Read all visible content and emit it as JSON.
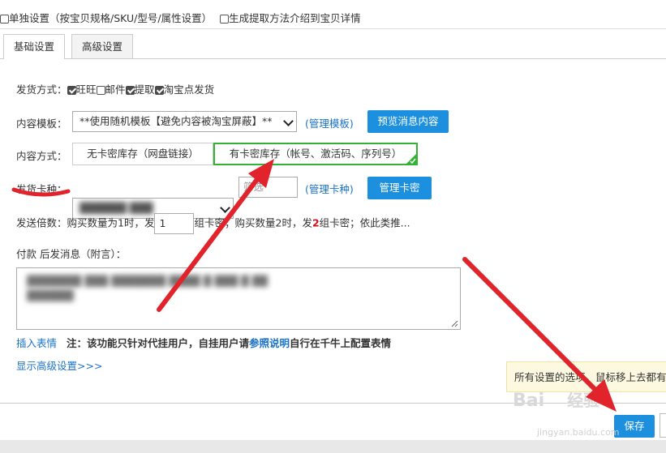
{
  "top_options": {
    "separate": "单独设置（按宝贝规格/SKU/型号/属性设置）",
    "intro": "生成提取方法介绍到宝贝详情"
  },
  "tabs": [
    {
      "label": "基础设置",
      "active": true
    },
    {
      "label": "高级设置",
      "active": false
    }
  ],
  "delivery": {
    "label": "发货方式：",
    "options": [
      {
        "label": "旺旺",
        "checked": true
      },
      {
        "label": "邮件",
        "checked": false
      },
      {
        "label": "提取",
        "checked": true
      },
      {
        "label": "淘宝点发货",
        "checked": true
      }
    ]
  },
  "template": {
    "label": "内容模板：",
    "selected": "**使用随机模板【避免内容被淘宝屏蔽】**",
    "manage_link": "(管理模板)",
    "preview_button": "预览消息内容"
  },
  "content_mode": {
    "label": "内容方式：",
    "option_a": "无卡密库存（网盘链接）",
    "option_b": "有卡密库存（帐号、激活码、序列号）",
    "selected": "option_b"
  },
  "card_type": {
    "label": "发货卡种：",
    "selected": "██████ ███",
    "filter_placeholder": "筛选",
    "manage_link": "(管理卡种)",
    "manage_button": "管理卡密"
  },
  "multiple": {
    "label": "发送倍数：",
    "text1": "购买数量为1时，发",
    "value": "1",
    "text2": "组卡密；购买数量2时，发",
    "highlight": "2",
    "text3": "组卡密；依此类推..."
  },
  "message": {
    "label": "付款 后发消息（附言）：",
    "blurred_line1": "▓▓▓▓▓▓▓ ▓▓▓ ▓▓▓▓▓▓▓ ▓▓▓▓ ▓ ▓▓▓ ▓ ▓▓",
    "blurred_line2": "▓▓▓▓▓▓"
  },
  "footer_note": {
    "insert_emoji": "插入表情",
    "note_prefix": "注：该功能只针对代挂用户，自挂用户请",
    "ref_link": "参照说明",
    "note_suffix": "自行在千牛上配置表情"
  },
  "advanced_link": "显示高级设置>>>",
  "tooltip": "所有设置的选项，鼠标移上去都有",
  "save_button": "保存",
  "watermark": {
    "brand": "Bai",
    "brand2": "经验",
    "url": "jingyan.baidu.com"
  },
  "colors": {
    "accent_blue": "#1c8fde",
    "annotation_red": "#e1232b",
    "selected_green": "#34b234"
  }
}
